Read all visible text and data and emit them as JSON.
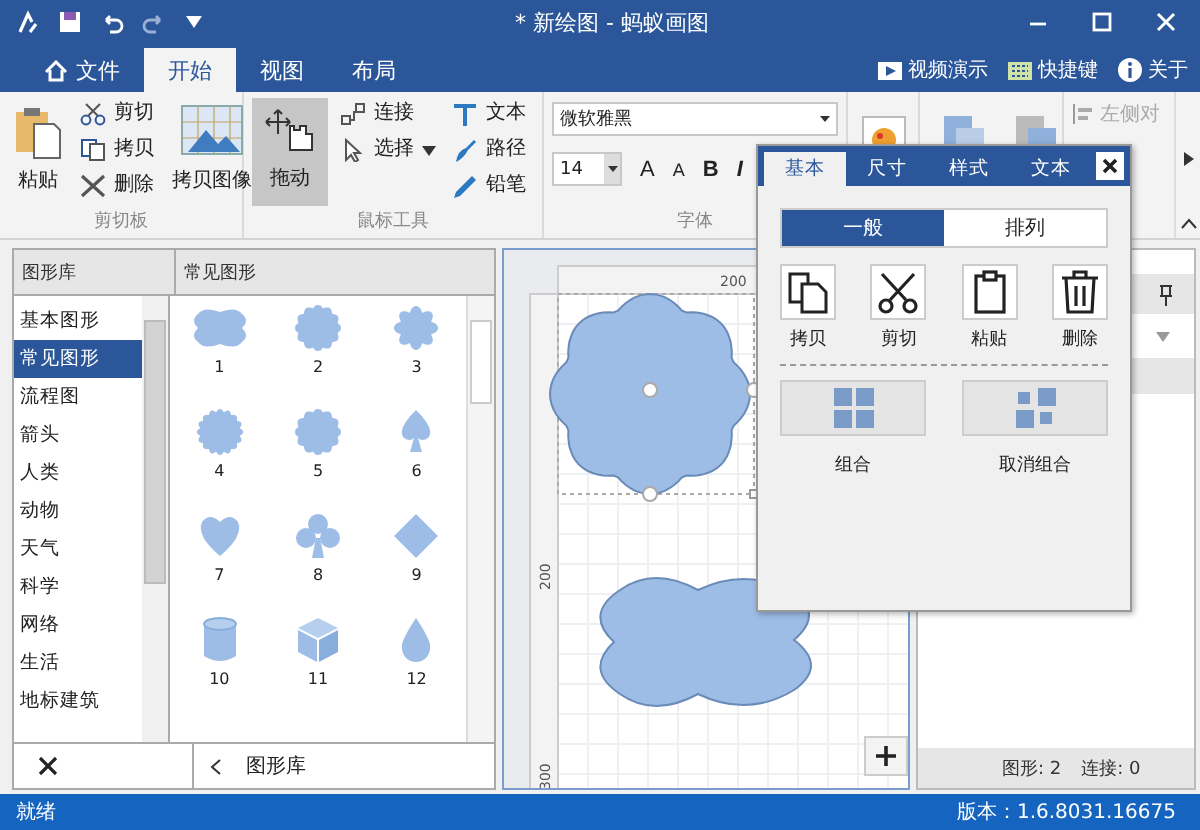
{
  "title_bar": {
    "title": "* 新绘图 - 蚂蚁画图"
  },
  "menu_tabs": [
    {
      "label": "文件",
      "kind": "home",
      "selected": false
    },
    {
      "label": "开始",
      "kind": "plain",
      "selected": true
    },
    {
      "label": "视图",
      "kind": "plain",
      "selected": false
    },
    {
      "label": "布局",
      "kind": "plain",
      "selected": false
    }
  ],
  "help_links": [
    {
      "kind": "video",
      "label": "视频演示"
    },
    {
      "kind": "keys",
      "label": "快捷键"
    },
    {
      "kind": "info",
      "label": "关于"
    }
  ],
  "clipboard": {
    "label": "剪切板",
    "paste": "粘贴",
    "small": [
      {
        "kind": "cut",
        "label": "剪切"
      },
      {
        "kind": "copy",
        "label": "拷贝"
      },
      {
        "kind": "delete",
        "label": "删除"
      }
    ],
    "copy_image": "拷贝图像"
  },
  "mouse_tools": {
    "label": "鼠标工具",
    "drag": {
      "label": "拖动",
      "selected": true
    },
    "column_1": [
      {
        "kind": "connect",
        "label": "连接"
      },
      {
        "kind": "select",
        "label": "选择"
      }
    ],
    "column_2": [
      {
        "kind": "text",
        "label": "文本"
      },
      {
        "kind": "path",
        "label": "路径"
      },
      {
        "kind": "pencil",
        "label": "铅笔"
      }
    ]
  },
  "font": {
    "label": "字体",
    "family": "微软雅黑",
    "size": "14",
    "buttons": [
      {
        "kind": "grow",
        "label": "A"
      },
      {
        "kind": "shrink",
        "label": "A"
      },
      {
        "kind": "bold",
        "label": "B"
      },
      {
        "kind": "italic",
        "label": "I"
      }
    ]
  },
  "align": {
    "label": "左侧对"
  },
  "library": {
    "header": "图形库",
    "shapes_header": "常见图形",
    "categories": [
      {
        "label": "基本图形",
        "selected": false
      },
      {
        "label": "常见图形",
        "selected": true
      },
      {
        "label": "流程图",
        "selected": false
      },
      {
        "label": "箭头",
        "selected": false
      },
      {
        "label": "人类",
        "selected": false
      },
      {
        "label": "动物",
        "selected": false
      },
      {
        "label": "天气",
        "selected": false
      },
      {
        "label": "科学",
        "selected": false
      },
      {
        "label": "网络",
        "selected": false
      },
      {
        "label": "生活",
        "selected": false
      },
      {
        "label": "地标建筑",
        "selected": false
      }
    ],
    "shapes": [
      {
        "kind": "cloud",
        "label": "1"
      },
      {
        "kind": "scallop",
        "label": "2"
      },
      {
        "kind": "flower",
        "label": "3"
      },
      {
        "kind": "gear",
        "label": "4"
      },
      {
        "kind": "scallop",
        "label": "5"
      },
      {
        "kind": "spade",
        "label": "6"
      },
      {
        "kind": "heart",
        "label": "7"
      },
      {
        "kind": "club",
        "label": "8"
      },
      {
        "kind": "diamond",
        "label": "9"
      },
      {
        "kind": "cylinder",
        "label": "10"
      },
      {
        "kind": "cube",
        "label": "11"
      },
      {
        "kind": "drop",
        "label": "12"
      }
    ],
    "footer": "图形库"
  },
  "canvas": {
    "top_ruler": [
      "200"
    ],
    "left_ruler": [
      "200",
      "300"
    ]
  },
  "info_panel": {
    "shapes": "图形: 2",
    "connections": "连接: 0"
  },
  "popup": {
    "tabs": [
      {
        "label": "基本",
        "selected": true
      },
      {
        "label": "尺寸",
        "selected": false
      },
      {
        "label": "样式",
        "selected": false
      },
      {
        "label": "文本",
        "selected": false
      }
    ],
    "segments": [
      {
        "label": "一般",
        "selected": true
      },
      {
        "label": "排列",
        "selected": false
      }
    ],
    "actions": [
      {
        "kind": "copy",
        "label": "拷贝"
      },
      {
        "kind": "cut",
        "label": "剪切"
      },
      {
        "kind": "paste",
        "label": "粘贴"
      },
      {
        "kind": "delete",
        "label": "删除"
      }
    ],
    "groups": [
      {
        "kind": "group",
        "label": "组合"
      },
      {
        "kind": "ungroup",
        "label": "取消组合"
      }
    ]
  },
  "status_bar": {
    "left": "就绪",
    "right": "版本：1.6.8031.16675"
  }
}
